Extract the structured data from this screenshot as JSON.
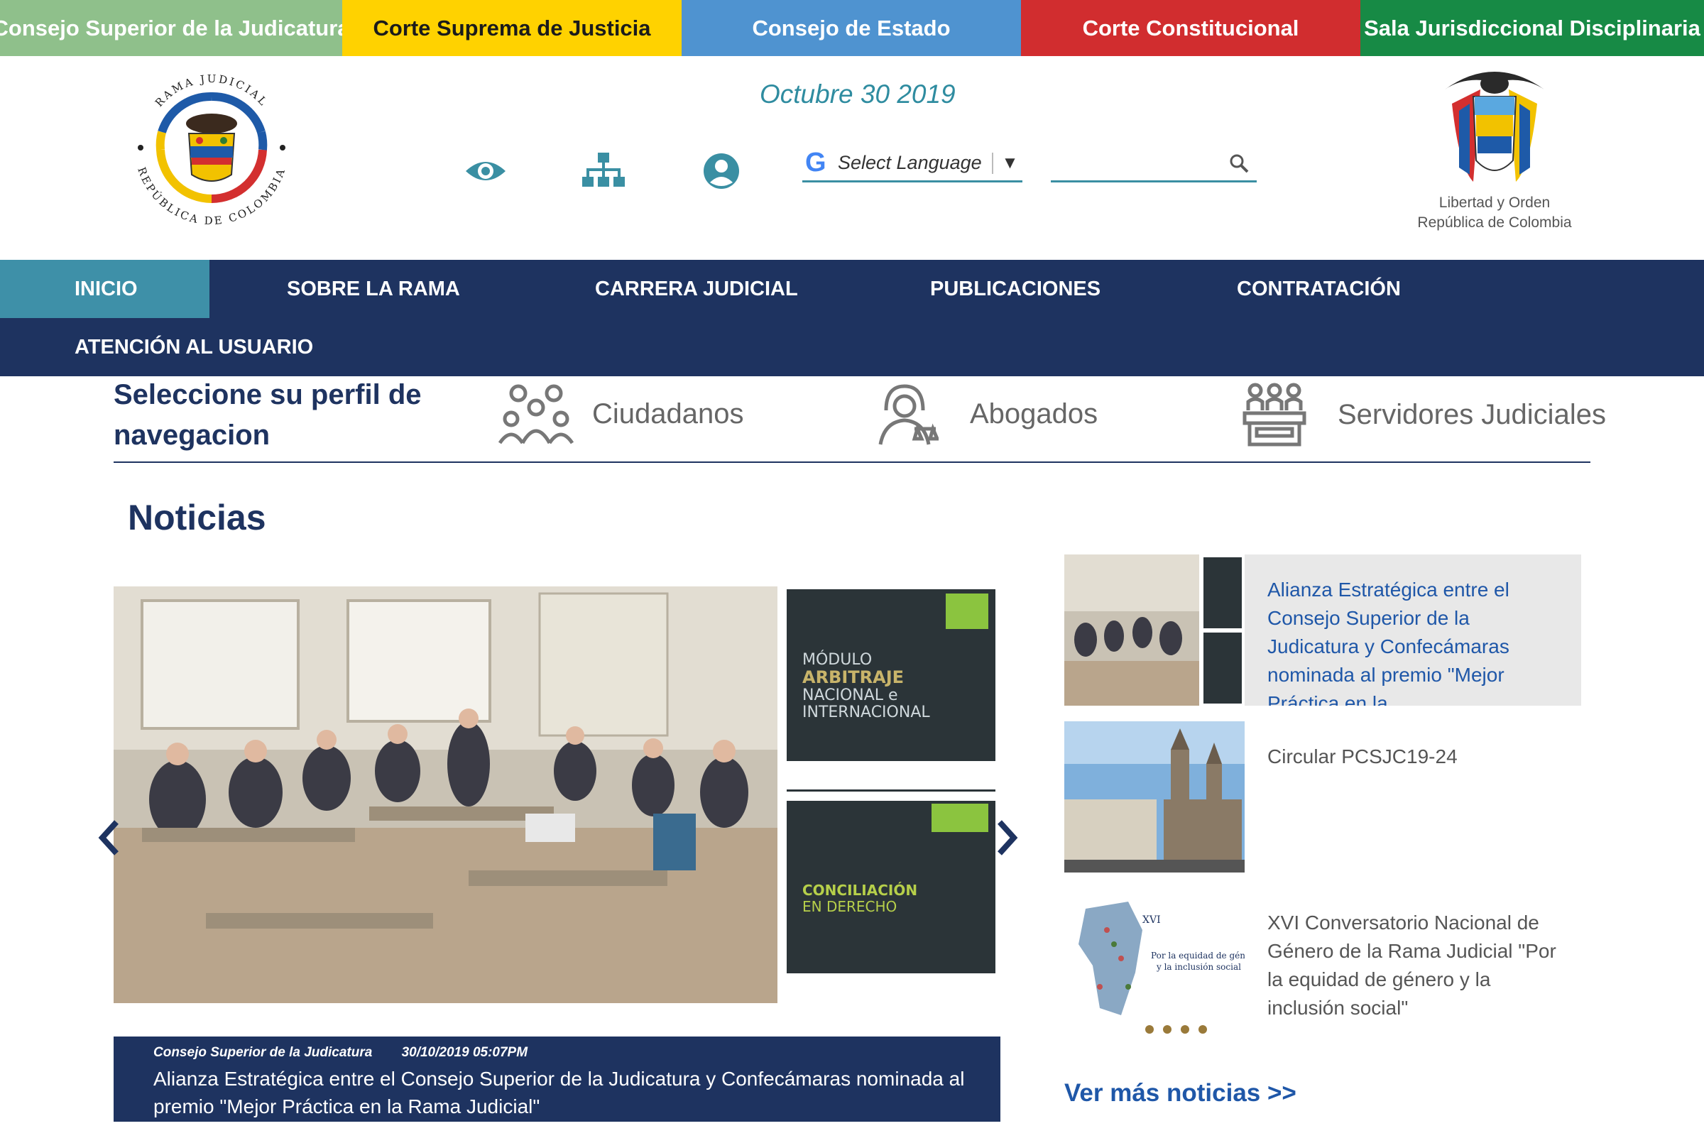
{
  "topbar": {
    "items": [
      {
        "label": "Consejo Superior de la Judicatura"
      },
      {
        "label": "Corte Suprema de Justicia"
      },
      {
        "label": "Consejo de Estado"
      },
      {
        "label": "Corte Constitucional"
      },
      {
        "label": "Sala Jurisdiccional Disciplinaria"
      }
    ]
  },
  "header": {
    "date": "Octubre 30 2019",
    "logo_left_top": "RAMA JUDICIAL",
    "logo_left_bottom": "REPÚBLICA DE COLOMBIA",
    "logo_right_line1": "Libertad y Orden",
    "logo_right_line2": "República de Colombia",
    "language_label": "Select Language",
    "search_placeholder": ""
  },
  "nav": {
    "items": [
      {
        "label": "INICIO"
      },
      {
        "label": "SOBRE LA RAMA"
      },
      {
        "label": "CARRERA JUDICIAL"
      },
      {
        "label": "PUBLICACIONES"
      },
      {
        "label": "CONTRATACIÓN"
      },
      {
        "label": "ATENCIÓN AL USUARIO"
      }
    ]
  },
  "profiles": {
    "title": "Seleccione su perfil de navegacion",
    "items": [
      {
        "label": "Ciudadanos",
        "icon": "group-icon"
      },
      {
        "label": "Abogados",
        "icon": "lawyer-icon"
      },
      {
        "label": "Servidores Judiciales",
        "icon": "court-icon"
      }
    ]
  },
  "news": {
    "title": "Noticias",
    "hero": {
      "book1_line1": "MÓDULO",
      "book1_line2": "ARBITRAJE",
      "book1_line3": "NACIONAL e",
      "book1_line4": "INTERNACIONAL",
      "book2_line1": "CONCILIACIÓN",
      "book2_line2": "EN DERECHO"
    },
    "caption": {
      "source": "Consejo Superior de la Judicatura",
      "datetime": "30/10/2019 05:07PM",
      "headline": "Alianza Estratégica entre el Consejo Superior de la Judicatura y Confecámaras nominada al premio \"Mejor Práctica en la Rama Judicial\""
    },
    "side": [
      {
        "text": "Alianza Estratégica entre el Consejo Superior de la Judicatura y Confecámaras nominada al premio \"Mejor Práctica en la"
      },
      {
        "text": "Circular PCSJC19-24"
      },
      {
        "text": "XVI Conversatorio Nacional de Género de la Rama Judicial \"Por la equidad de género y la inclusión social\""
      }
    ],
    "poster": {
      "line1": "XVI",
      "line2": "Por la equidad de género",
      "line3": "y la inclusión social"
    },
    "more_label": "Ver más noticias >>"
  }
}
